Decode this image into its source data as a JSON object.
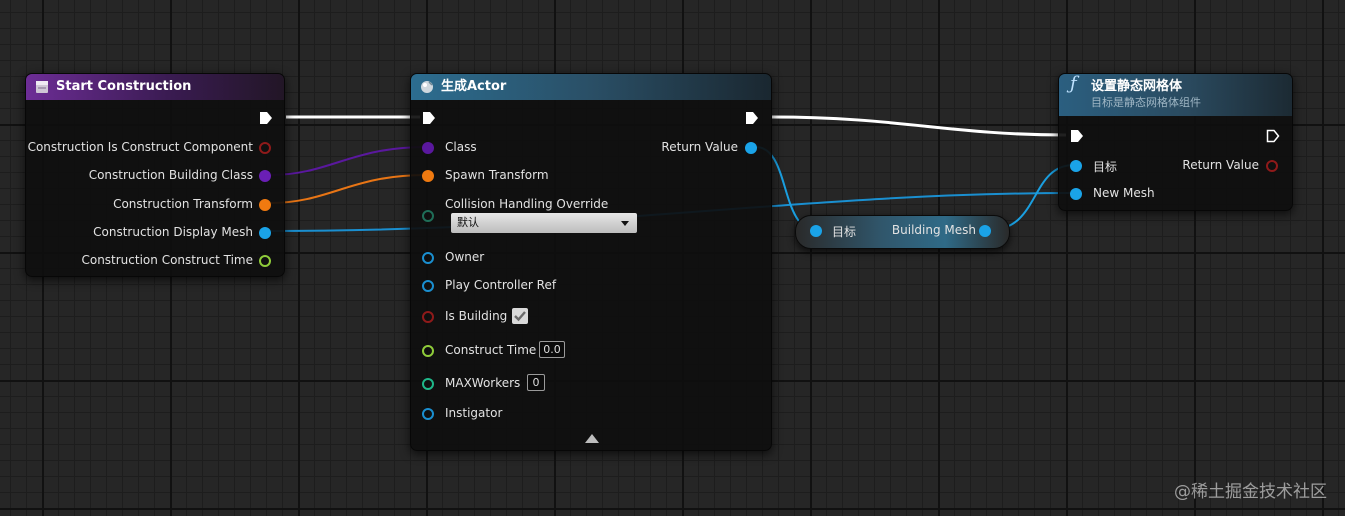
{
  "node_start": {
    "title": "Start Construction",
    "pins": [
      {
        "label": "Construction Is Construct Component"
      },
      {
        "label": "Construction Building Class"
      },
      {
        "label": "Construction Transform"
      },
      {
        "label": "Construction Display Mesh"
      },
      {
        "label": "Construction Construct Time"
      }
    ]
  },
  "node_spawn": {
    "title": "生成Actor",
    "inputs": {
      "class": "Class",
      "spawn_transform": "Spawn Transform",
      "collision": "Collision Handling Override",
      "collision_value": "默认",
      "owner": "Owner",
      "play_controller": "Play Controller Ref",
      "is_building": "Is Building",
      "construct_time": "Construct Time",
      "construct_time_value": "0.0",
      "max_workers": "MAXWorkers",
      "max_workers_value": "0",
      "instigator": "Instigator"
    },
    "output_return": "Return Value"
  },
  "node_get": {
    "target": "目标",
    "output": "Building Mesh"
  },
  "node_set": {
    "icon": "ƒ",
    "title": "设置静态网格体",
    "subtitle": "目标是静态网格体组件",
    "target": "目标",
    "new_mesh": "New Mesh",
    "return": "Return Value"
  },
  "colors": {
    "exec": "#ffffff",
    "object": "#1aa3e8",
    "class": "#6a1fb5",
    "struct": "#f07a10",
    "bool": "#8f1a1a",
    "float": "#8fcc3a",
    "int": "#1fb88a"
  },
  "watermark": "@稀土掘金技术社区"
}
